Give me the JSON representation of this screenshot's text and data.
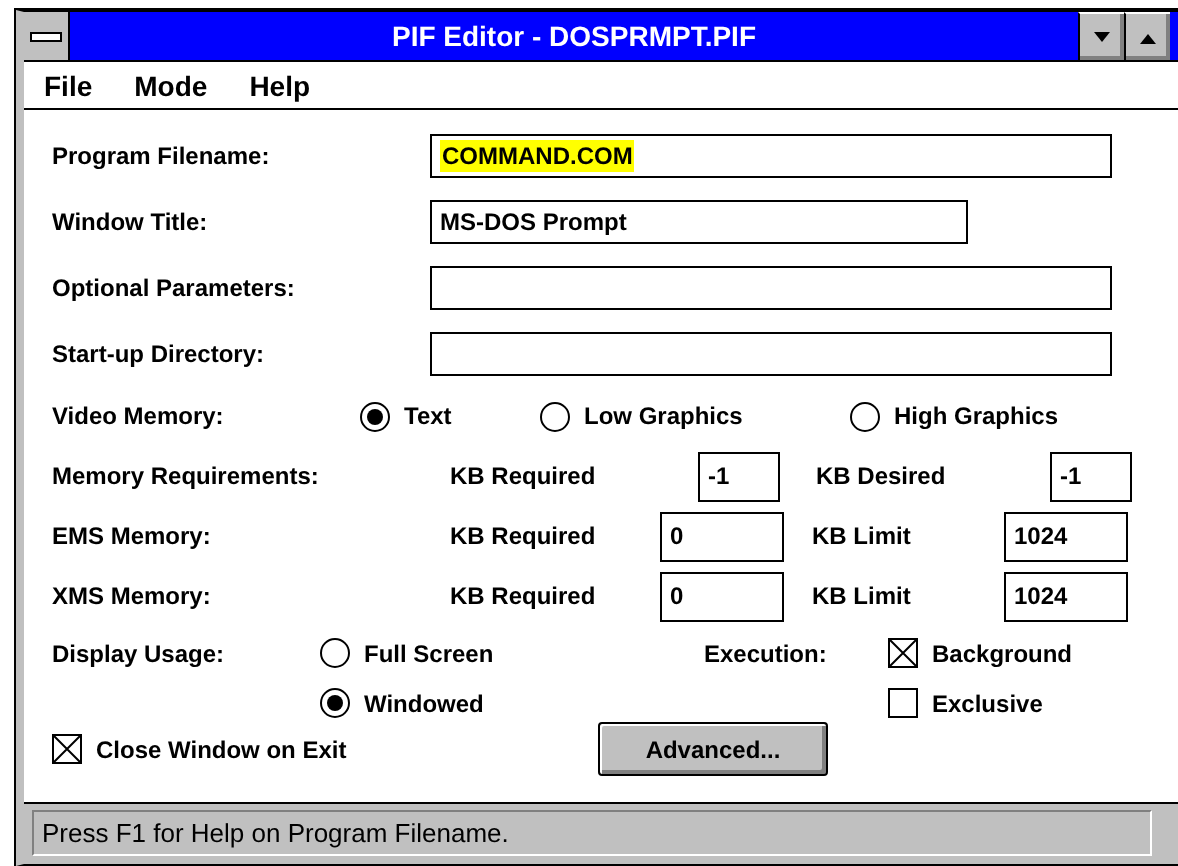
{
  "window": {
    "title": "PIF Editor - DOSPRMPT.PIF"
  },
  "menu": [
    {
      "label": "File"
    },
    {
      "label": "Mode"
    },
    {
      "label": "Help"
    }
  ],
  "fields": [
    {
      "label": "Program Filename:",
      "value": "COMMAND.COM",
      "selected": true,
      "kind": "long"
    },
    {
      "label": "Window Title:",
      "value": "MS-DOS Prompt",
      "selected": false,
      "kind": "short"
    },
    {
      "label": "Optional Parameters:",
      "kind": "long"
    },
    {
      "label": "Start-up Directory:",
      "kind": "long"
    }
  ],
  "video_memory": {
    "label": "Video Memory:",
    "options": [
      {
        "label": "Text",
        "selected": true
      },
      {
        "label": "Low Graphics",
        "selected": false
      },
      {
        "label": "High Graphics",
        "selected": false
      }
    ]
  },
  "memory_rows": [
    {
      "kind": "narrow",
      "label": "Memory Requirements:",
      "first_label": "KB Required",
      "first_value": "-1",
      "second_label": "KB Desired",
      "second_value": "-1"
    },
    {
      "kind": "wide",
      "label": "EMS Memory:",
      "first_label": "KB Required",
      "first_value": "0",
      "second_label": "KB Limit",
      "second_value": "1024"
    },
    {
      "kind": "wide",
      "label": "XMS Memory:",
      "first_label": "KB Required",
      "first_value": "0",
      "second_label": "KB Limit",
      "second_value": "1024"
    }
  ],
  "display_usage": {
    "label": "Display Usage:",
    "options": [
      {
        "label": "Full Screen",
        "selected": false
      },
      {
        "label": "Windowed",
        "selected": true
      }
    ]
  },
  "execution": {
    "label": "Execution:",
    "options": [
      {
        "label": "Background",
        "checked": true
      },
      {
        "label": "Exclusive",
        "checked": false
      }
    ]
  },
  "close_on_exit": {
    "label": "Close Window on Exit",
    "checked": true
  },
  "advanced_button": "Advanced...",
  "status_bar": "Press F1 for Help on Program Filename."
}
